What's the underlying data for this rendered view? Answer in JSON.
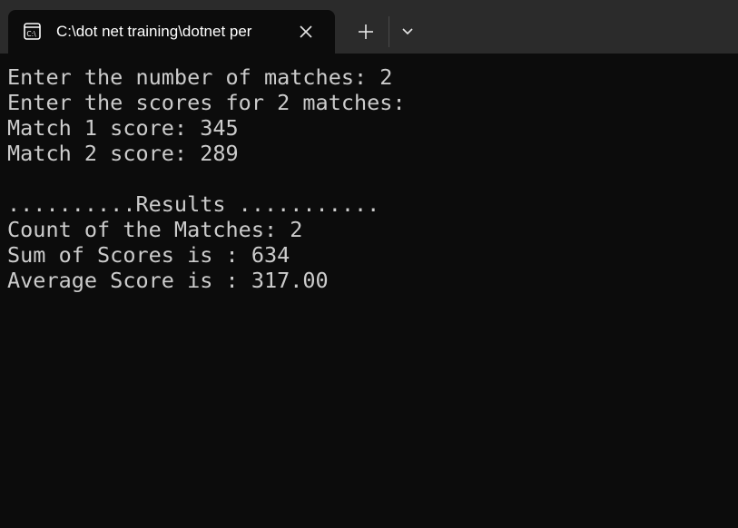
{
  "window": {
    "tab_title": "C:\\dot net training\\dotnet per",
    "tab_icon": "console-app-icon",
    "close_icon": "close-icon",
    "new_tab_icon": "plus-icon",
    "dropdown_icon": "chevron-down-icon"
  },
  "console": {
    "lines": [
      "Enter the number of matches: 2",
      "Enter the scores for 2 matches:",
      "Match 1 score: 345",
      "Match 2 score: 289",
      "",
      "..........Results ...........",
      "Count of the Matches: 2",
      "Sum of Scores is : 634",
      "Average Score is : 317.00"
    ]
  },
  "colors": {
    "titlebar_bg": "#2b2b2b",
    "terminal_bg": "#0c0c0c",
    "terminal_text": "#cccccc"
  }
}
